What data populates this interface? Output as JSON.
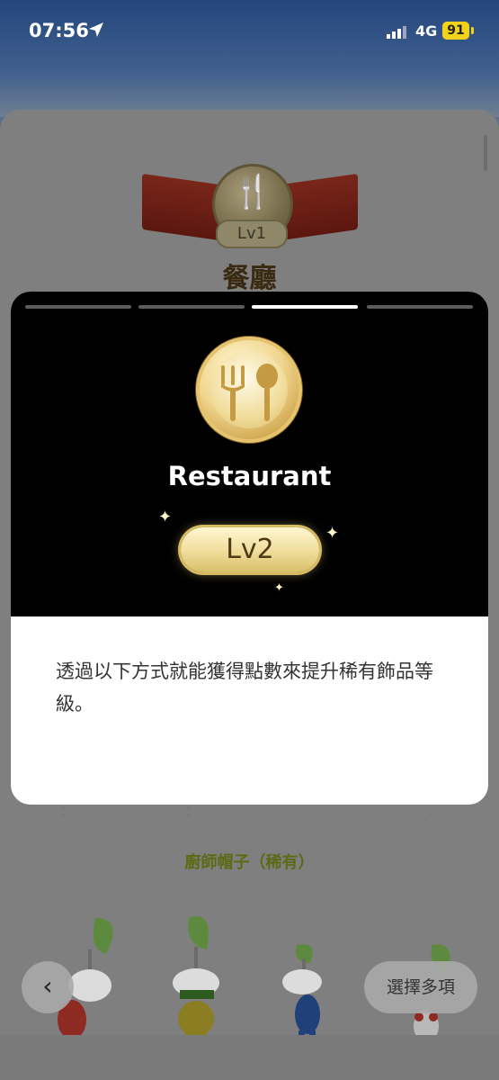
{
  "status_bar": {
    "time": "07:56",
    "network": "4G",
    "battery": "91"
  },
  "background_page": {
    "badge_level": "Lv1",
    "title": "餐廳",
    "item_name": "廚師帽子（稀有）",
    "select_multiple_label": "選擇多項",
    "back_glyph": "‹"
  },
  "modal": {
    "progress_segments": 4,
    "active_segment": 3,
    "category_name": "Restaurant",
    "level": "Lv2",
    "description": "透過以下方式就能獲得點數來提升稀有飾品等級。"
  },
  "colors": {
    "accent_gold": "#e6c36f",
    "battery": "#f2d21b",
    "item_title_green": "#5d6a14"
  },
  "icons": [
    "location-arrow-icon",
    "signal-icon",
    "fork-icon",
    "spoon-icon",
    "sparkle-icon",
    "chevron-left-icon"
  ]
}
